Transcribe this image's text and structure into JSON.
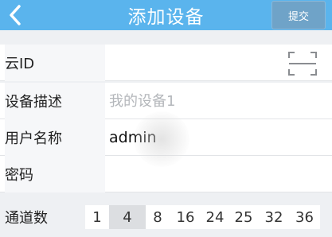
{
  "header": {
    "title": "添加设备",
    "submit_label": "提交"
  },
  "form": {
    "cloud_id": {
      "label": "云ID",
      "value": ""
    },
    "device_desc": {
      "label": "设备描述",
      "placeholder": "我的设备1",
      "value": ""
    },
    "username": {
      "label": "用户名称",
      "value": "admin"
    },
    "password": {
      "label": "密码",
      "value": ""
    }
  },
  "channels": {
    "label": "通道数",
    "options": [
      "1",
      "4",
      "8",
      "16",
      "24",
      "25",
      "32",
      "36"
    ],
    "selected": "4"
  },
  "colors": {
    "header_bg": "#5ab4ed",
    "submit_bg": "#6fa3c8"
  },
  "icons": {
    "back": "chevron-left-icon",
    "scan": "qr-scan-icon"
  }
}
